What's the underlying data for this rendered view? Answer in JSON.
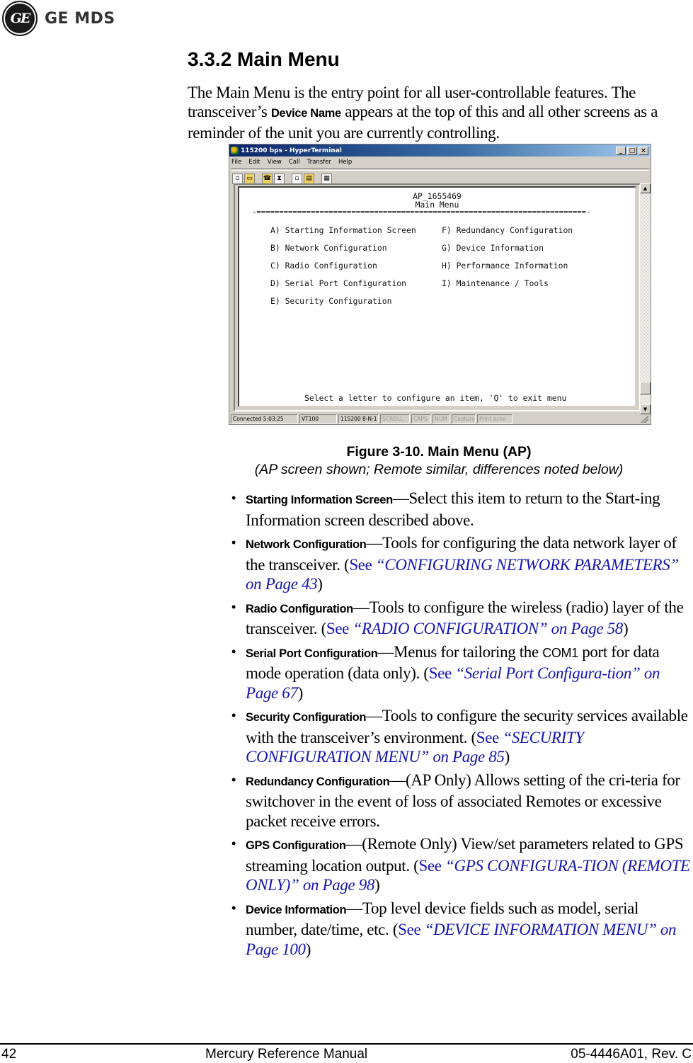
{
  "brand": {
    "monogram": "GE",
    "name": "GE MDS"
  },
  "section": {
    "heading": "3.3.2 Main Menu",
    "intro_before": "The Main Menu is the entry point for all user-controllable features. The transceiver’s ",
    "intro_term": "Device Name",
    "intro_after": " appears at the top of this and all other screens as a reminder of the unit you are currently controlling."
  },
  "terminal": {
    "title": "115200 bps - HyperTerminal",
    "window_buttons": {
      "minimize": "_",
      "maximize": "□",
      "close": "×"
    },
    "menus": [
      "File",
      "Edit",
      "View",
      "Call",
      "Transfer",
      "Help"
    ],
    "toolbar_icons": [
      "new-icon",
      "open-icon",
      "call-icon",
      "disconnect-icon",
      "send-icon",
      "receive-icon",
      "properties-icon"
    ],
    "device_name": "AP_1655469",
    "screen_title": "Main Menu",
    "rule": "-=========================================================================-",
    "left_items": [
      "A) Starting Information Screen",
      "B) Network Configuration",
      "C) Radio Configuration",
      "D) Serial Port Configuration",
      "E) Security Configuration"
    ],
    "right_items": [
      "F) Redundancy Configuration",
      "G) Device Information",
      "H) Performance Information",
      "I) Maintenance / Tools"
    ],
    "prompt": "Select a letter to configure an item, 'Q' to exit menu",
    "scroll_position": 0.95,
    "status": [
      {
        "label": "Connected 5:03:25",
        "dim": false
      },
      {
        "label": "VT100",
        "dim": false
      },
      {
        "label": "115200 8-N-1",
        "dim": false
      },
      {
        "label": "SCROLL",
        "dim": true
      },
      {
        "label": "CAPS",
        "dim": true
      },
      {
        "label": "NUM",
        "dim": true
      },
      {
        "label": "Capture",
        "dim": true
      },
      {
        "label": "Print echo",
        "dim": true
      }
    ]
  },
  "figure": {
    "caption": "Figure 3-10. Main Menu (AP)",
    "subcaption": "(AP screen shown; Remote similar, differences noted below)"
  },
  "bullets": [
    {
      "term": "Starting Information Screen",
      "text": "—Select this item to return to the Start-ing Information screen described above."
    },
    {
      "term": "Network Configuration",
      "text": "—Tools for configuring the data network layer of the transceiver. (",
      "see": "See ",
      "ref": "“CONFIGURING NETWORK PARAMETERS” on Page 43",
      "close": ")"
    },
    {
      "term": "Radio Configuration",
      "text": "—Tools to configure the wireless (radio) layer of the transceiver. (",
      "see": "See ",
      "ref": "“RADIO CONFIGURATION” on Page 58",
      "close": ")"
    },
    {
      "term": "Serial Port Configuration",
      "text": "—Menus for tailoring the ",
      "code": "COM1",
      "text2": " port for data mode operation (data only). (",
      "see": "See ",
      "ref": "“Serial Port Configura-tion” on Page 67",
      "close": ")"
    },
    {
      "term": "Security Configuration",
      "text": "—Tools to configure the security services available with the transceiver’s environment. (",
      "see": "See ",
      "ref": "“SECURITY CONFIGURATION MENU” on Page 85",
      "close": ")"
    },
    {
      "term": "Redundancy Configuration",
      "text": "—(AP Only) Allows setting of the cri-teria for switchover in the event of loss of associated Remotes or excessive packet receive errors."
    },
    {
      "term": "GPS Configuration",
      "text": "—(Remote Only) View/set parameters related to GPS streaming location output. (",
      "see": "See ",
      "ref": "“GPS CONFIGURA-TION (REMOTE ONLY)” on Page 98",
      "close": ")"
    },
    {
      "term": "Device Information",
      "text": "—Top level device fields such as model, serial number, date/time, etc. (",
      "see": "See ",
      "ref": "“DEVICE INFORMATION MENU” on Page 100",
      "close": ")"
    }
  ],
  "footer": {
    "page": "42",
    "title": "Mercury Reference Manual",
    "doc_id": "05-4446A01, Rev. C"
  }
}
